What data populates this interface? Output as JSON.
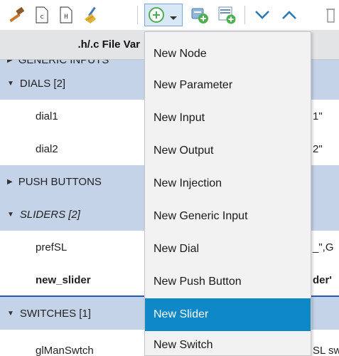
{
  "toolbar": {
    "icons": [
      "hammer-icon",
      "file-c-icon",
      "file-h-icon",
      "broom-icon",
      "add-dropdown-icon",
      "add-node-icon",
      "add-item-icon",
      "move-down-icon",
      "move-up-icon",
      "delete-icon"
    ],
    "colors": {
      "add_button_bg": "#d9e8f7",
      "add_green": "#4caf50",
      "chevron_blue": "#2a7ab8"
    }
  },
  "tree": {
    "header": ".h/.c File Var",
    "rows": [
      {
        "type": "category",
        "label": "GENERIC INPUTS",
        "expanded": false
      },
      {
        "type": "category",
        "label": "DIALS  [2]",
        "expanded": true
      },
      {
        "type": "item",
        "label": "dial1",
        "value": "1\""
      },
      {
        "type": "item",
        "label": "dial2",
        "value": "2\""
      },
      {
        "type": "category",
        "label": "PUSH BUTTONS",
        "expanded": false
      },
      {
        "type": "category",
        "label": "SLIDERS  [2]",
        "expanded": true
      },
      {
        "type": "item",
        "label": "prefSL",
        "value": "_\",G"
      },
      {
        "type": "item",
        "label": "new_slider",
        "value": "der'",
        "selected": true
      },
      {
        "type": "category",
        "label": "SWITCHES  [1]",
        "expanded": true
      },
      {
        "type": "item",
        "label": "glManSwtch",
        "value": "SL sw"
      }
    ]
  },
  "menu": {
    "items": [
      "New Node",
      "New Parameter",
      "New Input",
      "New Output",
      "New Injection",
      "New Generic Input",
      "New Dial",
      "New Push Button",
      "New Slider",
      "New Switch"
    ],
    "active_index": 8,
    "colors": {
      "active_bg": "#0f88c8",
      "menu_bg": "#f2f2f2"
    }
  }
}
